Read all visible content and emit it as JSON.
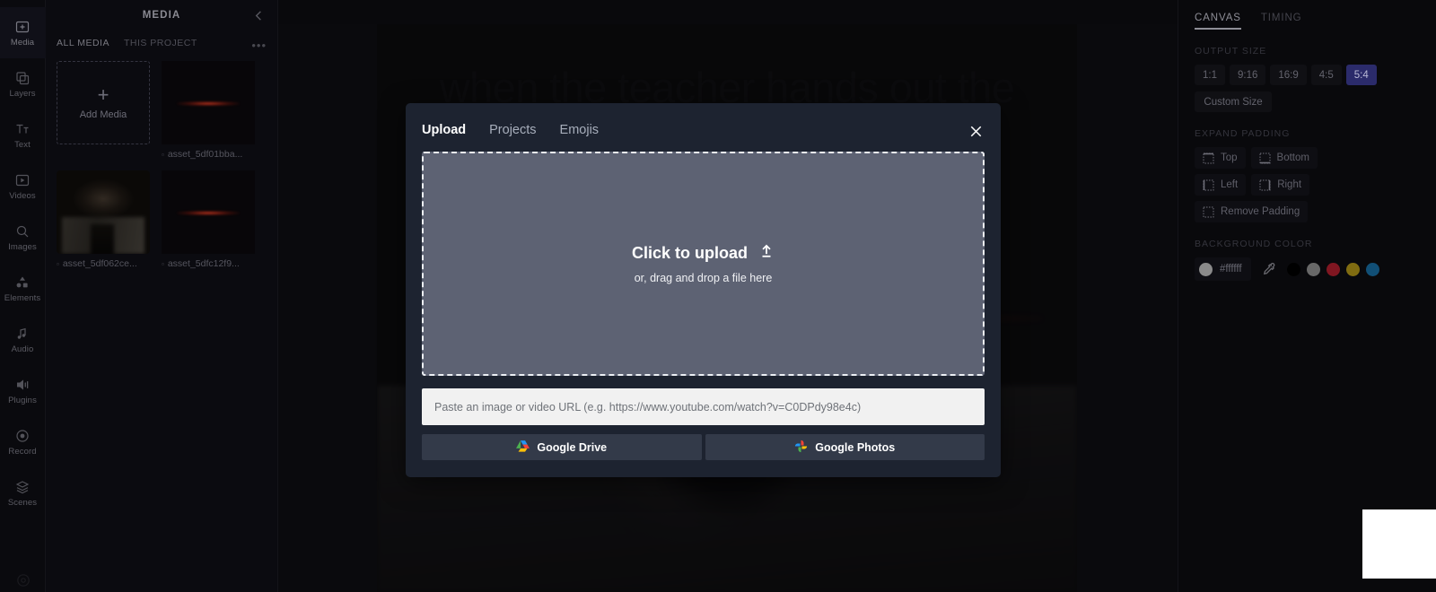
{
  "rail": {
    "items": [
      {
        "label": "Media",
        "icon": "media-icon",
        "active": true
      },
      {
        "label": "Layers",
        "icon": "layers-icon",
        "active": false
      },
      {
        "label": "Text",
        "icon": "text-icon",
        "active": false
      },
      {
        "label": "Videos",
        "icon": "videos-icon",
        "active": false
      },
      {
        "label": "Images",
        "icon": "images-search-icon",
        "active": false
      },
      {
        "label": "Elements",
        "icon": "elements-icon",
        "active": false
      },
      {
        "label": "Audio",
        "icon": "audio-note-icon",
        "active": false
      },
      {
        "label": "Plugins",
        "icon": "plugins-icon",
        "active": false
      },
      {
        "label": "Record",
        "icon": "record-icon",
        "active": false
      },
      {
        "label": "Scenes",
        "icon": "scenes-icon",
        "active": false
      }
    ],
    "bottom_icon": "help-circle-icon"
  },
  "media_panel": {
    "title": "MEDIA",
    "collapse_icon": "chevron-left-icon",
    "more_icon": "ellipsis-icon",
    "more_label": "•••",
    "tabs": [
      {
        "label": "ALL MEDIA",
        "active": true
      },
      {
        "label": "THIS PROJECT",
        "active": false
      }
    ],
    "add_media": {
      "plus": "+",
      "label": "Add Media"
    },
    "assets": [
      {
        "name": "asset_5df01bba...",
        "kind_icon": "file-icon",
        "kind_glyph": "▫",
        "thumb": "flare"
      },
      {
        "name": "asset_5df062ce...",
        "kind_icon": "file-icon",
        "kind_glyph": "▫",
        "thumb": "photo"
      },
      {
        "name": "asset_5dfc12f9...",
        "kind_icon": "file-icon",
        "kind_glyph": "▫",
        "thumb": "flare"
      }
    ]
  },
  "canvas": {
    "caption": "when the teacher hands out the homework paper"
  },
  "modal": {
    "tabs": [
      {
        "label": "Upload",
        "active": true
      },
      {
        "label": "Projects",
        "active": false
      },
      {
        "label": "Emojis",
        "active": false
      }
    ],
    "close_icon": "close-icon",
    "dropzone": {
      "main_label": "Click to upload",
      "upload_icon": "upload-arrow-icon",
      "sub_label": "or, drag and drop a file here"
    },
    "url_input": {
      "value": "",
      "placeholder": "Paste an image or video URL (e.g. https://www.youtube.com/watch?v=C0DPdy98e4c)"
    },
    "buttons": [
      {
        "label": "Google Drive",
        "icon": "google-drive-icon"
      },
      {
        "label": "Google Photos",
        "icon": "google-photos-icon"
      }
    ]
  },
  "right_panel": {
    "tabs": [
      {
        "label": "CANVAS",
        "active": true
      },
      {
        "label": "TIMING",
        "active": false
      }
    ],
    "output_size": {
      "title": "OUTPUT SIZE",
      "ratios": [
        {
          "label": "1:1",
          "selected": false
        },
        {
          "label": "9:16",
          "selected": false
        },
        {
          "label": "16:9",
          "selected": false
        },
        {
          "label": "4:5",
          "selected": false
        },
        {
          "label": "5:4",
          "selected": true
        }
      ],
      "custom_label": "Custom Size"
    },
    "expand_padding": {
      "title": "EXPAND PADDING",
      "options": [
        {
          "label": "Top",
          "icon": "padding-top-icon"
        },
        {
          "label": "Bottom",
          "icon": "padding-bottom-icon"
        },
        {
          "label": "Left",
          "icon": "padding-left-icon"
        },
        {
          "label": "Right",
          "icon": "padding-right-icon"
        },
        {
          "label": "Remove Padding",
          "icon": "padding-remove-icon"
        }
      ]
    },
    "background_color": {
      "title": "BACKGROUND COLOR",
      "current_hex": "#ffffff",
      "eyedropper_icon": "eyedropper-icon",
      "swatches": [
        "#000000",
        "#bdbdbd",
        "#e8283c",
        "#e8c41f",
        "#1f8fd6"
      ]
    },
    "accent_selected": "#2b2b6b"
  }
}
